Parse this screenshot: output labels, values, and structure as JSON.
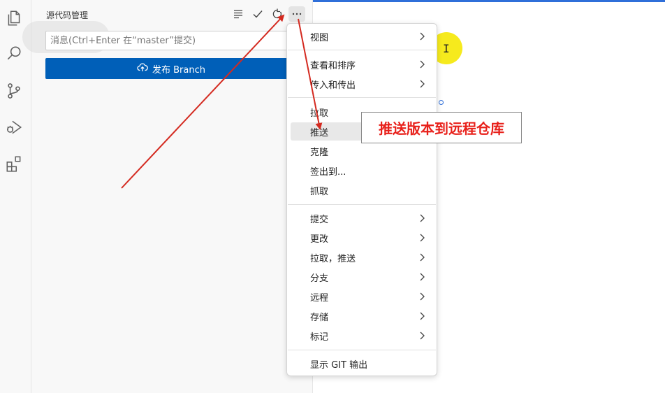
{
  "panel": {
    "title": "源代码管理",
    "commit_placeholder": "消息(Ctrl+Enter 在“master”提交)",
    "publish_label": "发布 Branch"
  },
  "menu": {
    "items": [
      {
        "label": "视图",
        "submenu": true
      },
      {
        "label": "查看和排序",
        "submenu": true
      },
      {
        "label": "传入和传出",
        "submenu": true
      },
      {
        "label": "拉取",
        "submenu": false
      },
      {
        "label": "推送",
        "submenu": false,
        "hover": true
      },
      {
        "label": "克隆",
        "submenu": false
      },
      {
        "label": "签出到...",
        "submenu": false
      },
      {
        "label": "抓取",
        "submenu": false
      },
      {
        "label": "提交",
        "submenu": true
      },
      {
        "label": "更改",
        "submenu": true
      },
      {
        "label": "拉取，推送",
        "submenu": true
      },
      {
        "label": "分支",
        "submenu": true
      },
      {
        "label": "远程",
        "submenu": true
      },
      {
        "label": "存储",
        "submenu": true
      },
      {
        "label": "标记",
        "submenu": true
      },
      {
        "label": "显示 GIT 输出",
        "submenu": false
      }
    ]
  },
  "annotation": {
    "text": "推送版本到远程仓库",
    "color": "#e8201a"
  },
  "colors": {
    "accent": "#005fb8",
    "arrow": "#d42a20",
    "cursor_highlight": "#f6ea1d"
  },
  "icons": {
    "activity": [
      "files-icon",
      "search-icon",
      "source-control-icon",
      "run-debug-icon",
      "extensions-icon"
    ],
    "panel_actions": [
      "view-as-tree-icon",
      "commit-check-icon",
      "refresh-icon",
      "more-actions-icon"
    ]
  }
}
